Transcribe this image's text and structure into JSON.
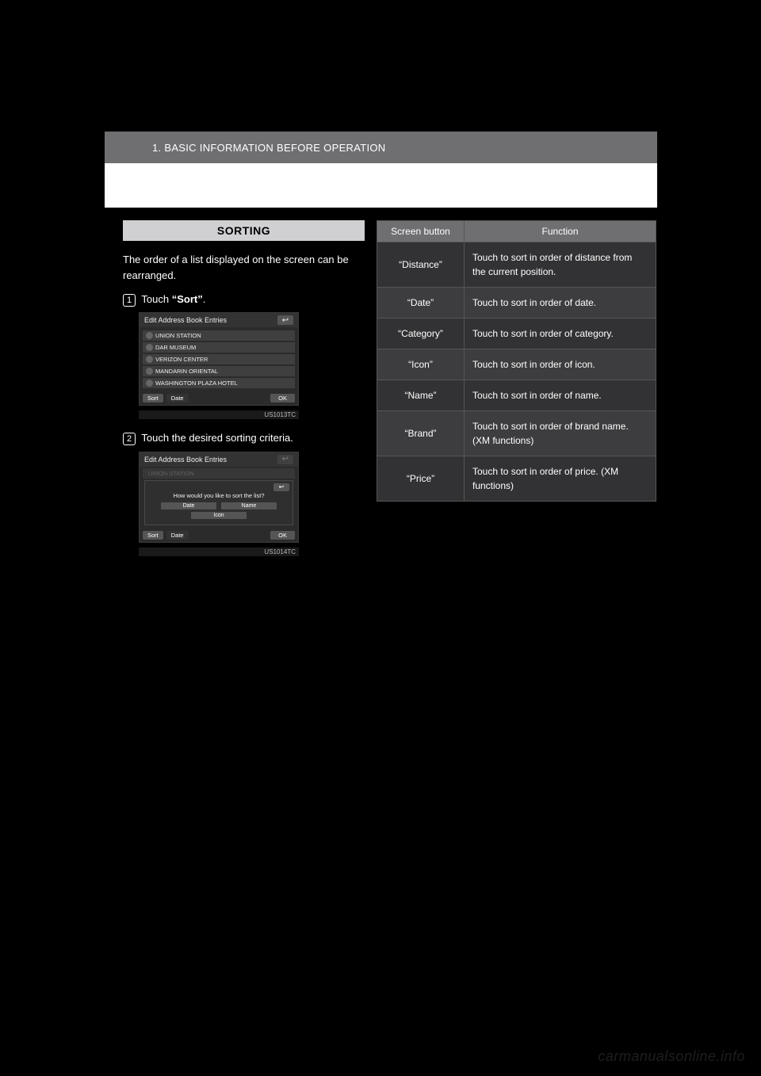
{
  "header": {
    "section": "1. BASIC INFORMATION BEFORE OPERATION"
  },
  "left": {
    "sorting_heading": "SORTING",
    "intro": "The order of a list displayed on the screen can be rearranged.",
    "step1_prefix": "Touch ",
    "step1_button": "“Sort”",
    "step1_suffix": ".",
    "step2": "Touch the desired sorting criteria."
  },
  "shot1": {
    "title": "Edit Address Book Entries",
    "items": [
      "UNION STATION",
      "DAR MUSEUM",
      "VERIZON CENTER",
      "MANDARIN ORIENTAL",
      "WASHINGTON PLAZA HOTEL"
    ],
    "sort_label": "Sort",
    "sort_mode": "Date",
    "ok": "OK",
    "code": "US1013TC"
  },
  "shot2": {
    "title": "Edit Address Book Entries",
    "dim_item": "UNION STATION",
    "dialog_title": "How would you like to sort the list?",
    "options": [
      "Date",
      "Name",
      "Icon"
    ],
    "sort_label": "Sort",
    "sort_mode": "Date",
    "ok": "OK",
    "code": "US1014TC"
  },
  "table": {
    "head_button": "Screen button",
    "head_function": "Function",
    "rows": [
      {
        "label": "“Distance”",
        "desc": "Touch to sort in order of distance from the current position."
      },
      {
        "label": "“Date”",
        "desc": "Touch to sort in order of date."
      },
      {
        "label": "“Category”",
        "desc": "Touch to sort in order of category."
      },
      {
        "label": "“Icon”",
        "desc": "Touch to sort in order of icon."
      },
      {
        "label": "“Name”",
        "desc": "Touch to sort in order of name."
      },
      {
        "label": "“Brand”",
        "desc": "Touch to sort in order of brand name. (XM functions)"
      },
      {
        "label": "“Price”",
        "desc": "Touch to sort in order of price. (XM functions)"
      }
    ]
  },
  "watermark": "carmanualsonline.info"
}
